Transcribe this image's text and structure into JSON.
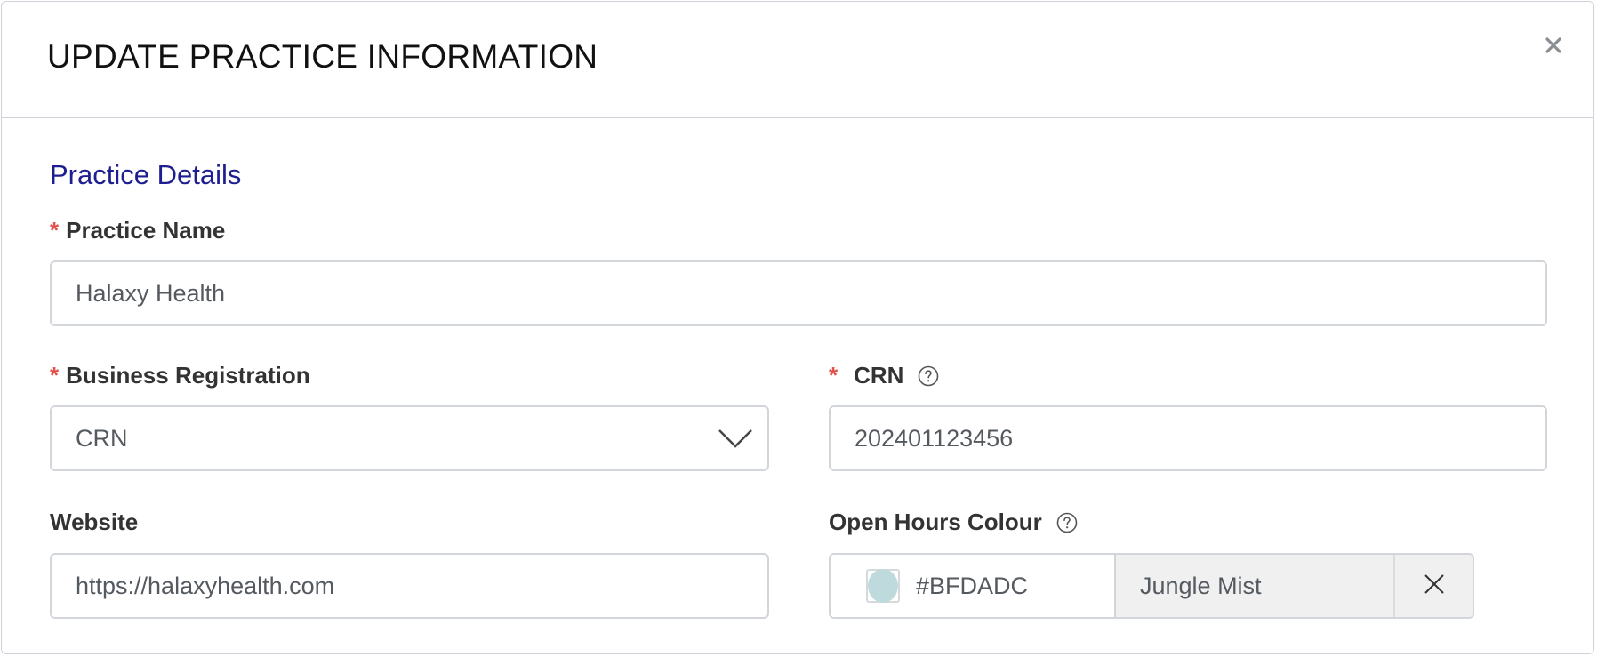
{
  "modal": {
    "title": "UPDATE PRACTICE INFORMATION",
    "close_icon": "close-icon"
  },
  "section": {
    "title": "Practice Details"
  },
  "practice_name": {
    "required_mark": "*",
    "label": "Practice Name",
    "value": "Halaxy Health"
  },
  "business_registration": {
    "required_mark": "*",
    "label": "Business Registration",
    "selected": "CRN",
    "icon": "chevron-down-icon"
  },
  "crn": {
    "required_mark": "*",
    "label": "CRN",
    "help_icon": "help-circle-icon",
    "value": "202401123456"
  },
  "website": {
    "label": "Website",
    "value": "https://halaxyhealth.com"
  },
  "open_hours_colour": {
    "label": "Open Hours Colour",
    "help_icon": "help-circle-icon",
    "hex": "#BFDADC",
    "swatch_color": "#BFDADC",
    "name": "Jungle Mist",
    "clear_icon": "close-icon"
  },
  "colors": {
    "accent_title": "#1C1E91",
    "required": "#E0534D",
    "border": "#D2D5DA"
  }
}
